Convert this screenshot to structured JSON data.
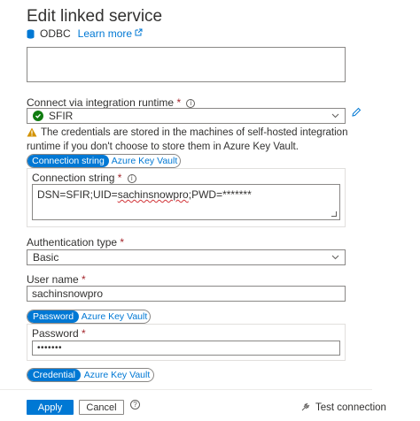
{
  "header": {
    "title": "Edit linked service",
    "connector": "ODBC",
    "learn_more": "Learn more"
  },
  "runtime": {
    "label": "Connect via integration runtime",
    "value": "SFIR",
    "warning": "The credentials are stored in the machines of self-hosted integration runtime if you don't choose to store them in Azure Key Vault."
  },
  "connection_tabs": {
    "active": "Connection string",
    "inactive": "Azure Key Vault"
  },
  "connection_string": {
    "label": "Connection string",
    "prefix": "DSN=SFIR;UID=",
    "user": "sachinsnowpro",
    "suffix": ";PWD=*******"
  },
  "auth": {
    "label": "Authentication type",
    "value": "Basic"
  },
  "username": {
    "label": "User name",
    "value": "sachinsnowpro"
  },
  "password_tabs": {
    "active": "Password",
    "inactive": "Azure Key Vault"
  },
  "password": {
    "label": "Password",
    "value": "•••••••"
  },
  "credential_tabs": {
    "active": "Credential",
    "inactive": "Azure Key Vault"
  },
  "footer": {
    "apply": "Apply",
    "cancel": "Cancel",
    "test": "Test connection"
  },
  "colors": {
    "accent": "#0078d4",
    "success": "#107c10",
    "warning": "#797775",
    "required": "#a4262c"
  },
  "icons": [
    "database-icon",
    "external-link-icon",
    "info-icon",
    "check-circle-icon",
    "chevron-down-icon",
    "pencil-icon",
    "warning-icon",
    "help-icon",
    "plug-icon"
  ]
}
